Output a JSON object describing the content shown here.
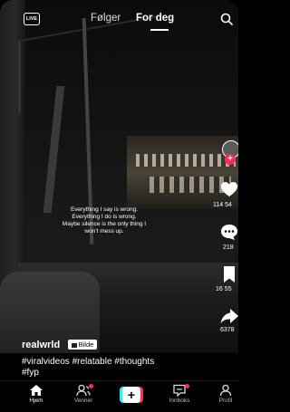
{
  "top_bar": {
    "live_label": "LIVE",
    "tab_following": "Følger",
    "tab_for_you": "For deg",
    "active_tab": "For deg"
  },
  "caption_lines": [
    "Everything I say is wrong.",
    "Everything I do is wrong.",
    "Maybe silence is the only thing I",
    "won't mess up."
  ],
  "actions": {
    "likes": "114 54",
    "comments": "218",
    "saves": "16 55",
    "shares": "6378"
  },
  "post": {
    "username": "realwrld",
    "badge_label": "Bilde",
    "hashtags_line1": "#viralvideos #relatable #thoughts",
    "hashtags_line2": "#fyp"
  },
  "nav": {
    "home": "Hjem",
    "friends": "Venner",
    "inbox": "Innboks",
    "profile": "Profil",
    "active": "Hjem"
  },
  "colors": {
    "accent_red": "#fe2c55",
    "accent_cyan": "#25f4ee",
    "background": "#000000"
  },
  "icons": [
    "live-icon",
    "search-icon",
    "heart-icon",
    "comment-icon",
    "bookmark-icon",
    "share-icon",
    "home-icon",
    "friends-icon",
    "plus-icon",
    "inbox-icon",
    "profile-icon"
  ]
}
